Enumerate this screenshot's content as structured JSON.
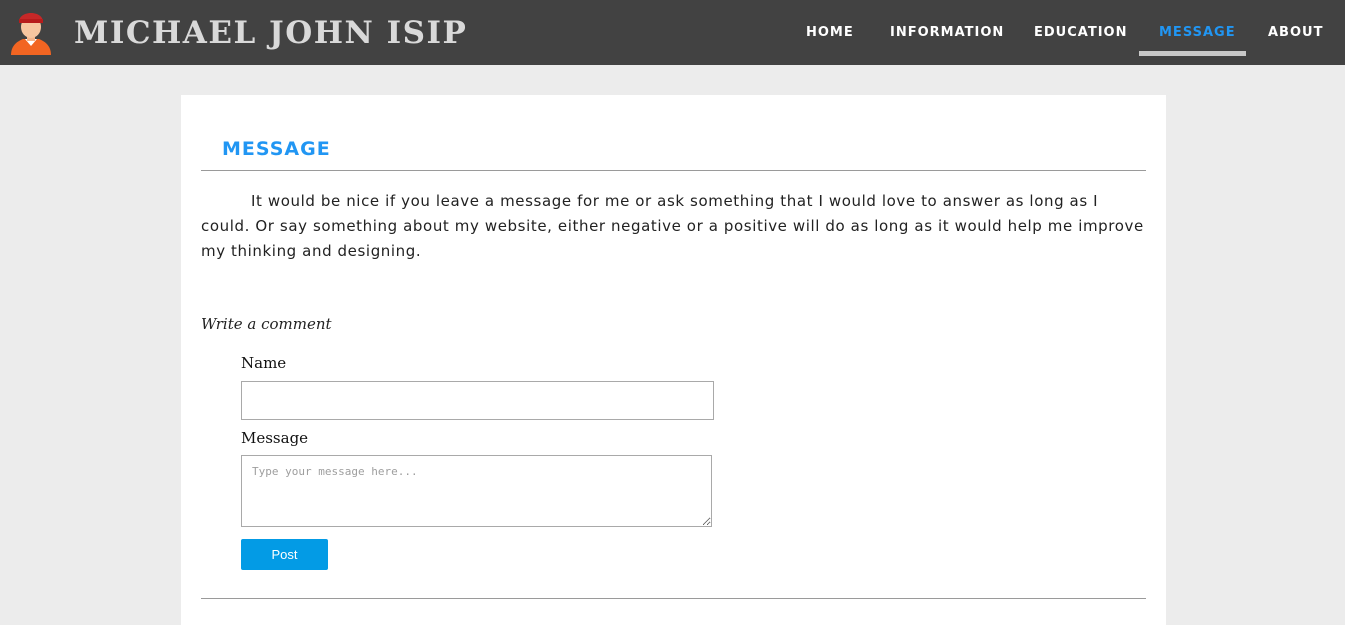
{
  "header": {
    "site_title": "MICHAEL JOHN ISIP",
    "avatar_icon": "person-avatar-icon",
    "nav": [
      {
        "label": "HOME",
        "active": false
      },
      {
        "label": "INFORMATION",
        "active": false
      },
      {
        "label": "EDUCATION",
        "active": false
      },
      {
        "label": "MESSAGE",
        "active": true
      },
      {
        "label": "ABOUT",
        "active": false
      }
    ]
  },
  "main": {
    "heading": "MESSAGE",
    "intro": "It would be nice if you leave a message for me or ask something that I would love to answer as long as I could. Or say something about my website, either negative or a positive will do as long as it would help me improve my thinking and designing.",
    "form": {
      "title": "Write a comment",
      "name_label": "Name",
      "name_value": "",
      "message_label": "Message",
      "message_value": "",
      "message_placeholder": "Type your message here...",
      "submit_label": "Post"
    }
  },
  "colors": {
    "header_bg": "#424242",
    "page_bg": "#ececec",
    "accent": "#2196f3",
    "button_bg": "#039be5",
    "title_text": "#d9d9d9"
  }
}
